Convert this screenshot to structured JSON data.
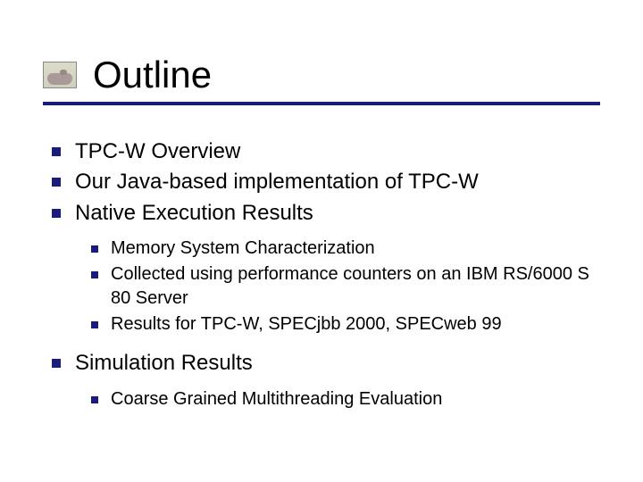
{
  "title": "Outline",
  "bullets": {
    "b0": "TPC-W Overview",
    "b1": "Our Java-based implementation of TPC-W",
    "b2": "Native Execution Results",
    "b2sub": {
      "s0": "Memory System Characterization",
      "s1": "Collected using performance counters on an IBM RS/6000 S 80 Server",
      "s2": "Results for TPC-W, SPECjbb 2000, SPECweb 99"
    },
    "b3": "Simulation Results",
    "b3sub": {
      "s0": "Coarse Grained Multithreading Evaluation"
    }
  }
}
